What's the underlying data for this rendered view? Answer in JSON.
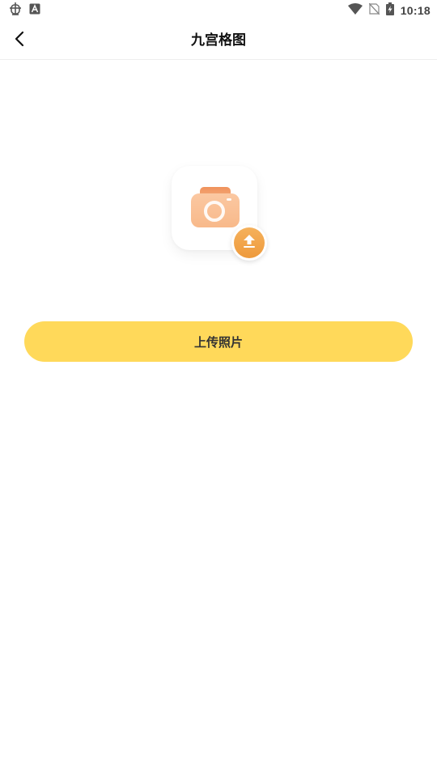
{
  "status_bar": {
    "left_icons": [
      "bug-icon",
      "text-a-icon"
    ],
    "right_icons": [
      "wifi-icon",
      "no-sim-icon",
      "battery-charging-icon"
    ],
    "time": "10:18"
  },
  "app_bar": {
    "back_icon": "chevron-left-icon",
    "title": "九宫格图"
  },
  "upload": {
    "illustration_icon": "camera-icon",
    "badge_icon": "upload-arrow-icon",
    "button_label": "上传照片"
  },
  "colors": {
    "accent": "#ffd95a",
    "badge": "#ee9a3c",
    "camera": "#f3a96c"
  }
}
